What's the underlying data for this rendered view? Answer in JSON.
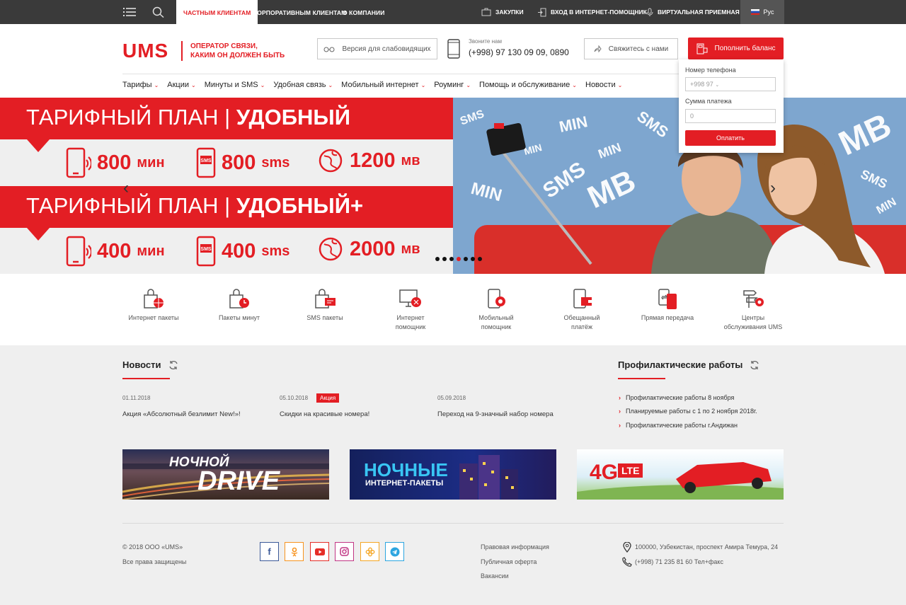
{
  "topbar": {
    "tabs": [
      "ЧАСТНЫМ КЛИЕНТАМ",
      "КОРПОРАТИВНЫМ КЛИЕНТАМ",
      "О КОМПАНИИ"
    ],
    "links": [
      "ЗАКУПКИ",
      "ВХОД В ИНТЕРНЕТ-ПОМОЩНИК",
      "ВИРТУАЛЬНАЯ ПРИЕМНАЯ"
    ],
    "lang": "Рус"
  },
  "header": {
    "logo": "UMS",
    "tagline_1": "ОПЕРАТОР СВЯЗИ,",
    "tagline_2": "КАКИМ ОН ДОЛЖЕН БЫТЬ",
    "low_vision": "Версия для слабовидящих",
    "call_label": "Звоните нам",
    "call_number": "(+998) 97 130 09 09, 0890",
    "contact": "Свяжитесь с нами",
    "topup": "Пополнить баланс"
  },
  "nav": [
    "Тарифы",
    "Акции",
    "Минуты и SMS",
    "Удобная связь",
    "Мобильный интернет",
    "Роуминг",
    "Помощь и обслуживание",
    "Новости"
  ],
  "banner": {
    "plan1": {
      "prefix": "ТАРИФНЫЙ ПЛАН",
      "name": "УДОБНЫЙ",
      "min": "800",
      "min_unit": "мин",
      "sms": "800",
      "sms_unit": "sms",
      "mb": "1200",
      "mb_unit": "мв"
    },
    "plan2": {
      "prefix": "ТАРИФНЫЙ ПЛАН",
      "name": "УДОБНЫЙ+",
      "min": "400",
      "min_unit": "мин",
      "sms": "400",
      "sms_unit": "sms",
      "mb": "2000",
      "mb_unit": "мв"
    },
    "slides_total": 7,
    "slide_active": 4
  },
  "popup": {
    "phone_label": "Номер телефона",
    "phone_prefix": "+998 97",
    "amount_label": "Сумма платежа",
    "amount_value": "0",
    "pay": "Оплатить"
  },
  "quick_links": [
    [
      "Интернет пакеты"
    ],
    [
      "Пакеты минут"
    ],
    [
      "SMS пакеты"
    ],
    [
      "Интернет",
      "помощник"
    ],
    [
      "Мобильный",
      "помощник"
    ],
    [
      "Обещанный",
      "платёж"
    ],
    [
      "Прямая передача"
    ],
    [
      "Центры",
      "обслуживания UMS"
    ]
  ],
  "news": {
    "title": "Новости",
    "items": [
      {
        "date": "01.11.2018",
        "text": "Акция «Абсолютный безлимит New!»!"
      },
      {
        "date": "05.10.2018",
        "badge": "Акция",
        "text": "Скидки на красивые номера!"
      },
      {
        "date": "05.09.2018",
        "text": "Переход на 9-значный набор номера"
      }
    ]
  },
  "maintenance": {
    "title": "Профилактические работы",
    "items": [
      "Профилактические работы 8 ноября",
      "Планируемые работы с 1 по 2 ноября 2018г.",
      "Профилактические работы г.Андижан"
    ]
  },
  "promos": {
    "p1_top": "НОЧНОЙ",
    "p1_big": "DRIVE",
    "p2_top": "НОЧНЫЕ",
    "p2_bottom": "ИНТЕРНЕТ-ПАКЕТЫ",
    "p3_big": "4G",
    "p3_tag": "LTE"
  },
  "footer": {
    "copyright": "© 2018 ООО «UMS»",
    "rights": "Все права защищены",
    "links": [
      "Правовая информация",
      "Публичная оферта",
      "Вакансии"
    ],
    "address": "100000, Узбекистан, проспект Амира Темура, 24",
    "phone": "(+998) 71 235 81 60 Тел+факс"
  },
  "colors": {
    "brand": "#e31e24",
    "topbar": "#3a3a3a"
  }
}
